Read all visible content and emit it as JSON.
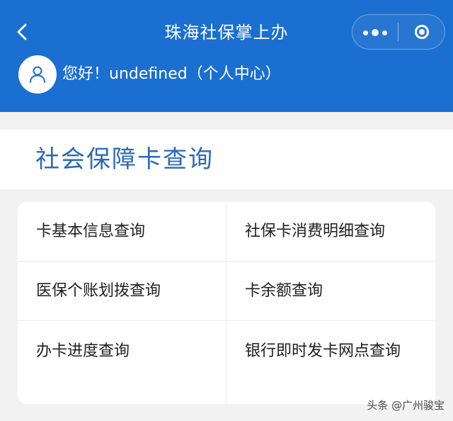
{
  "header": {
    "title": "珠海社保掌上办",
    "back_icon": "chevron-left-icon",
    "capsule": {
      "more_icon": "more-dots-icon",
      "close_icon": "target-close-icon"
    },
    "background_color": "#1a6fd0"
  },
  "user": {
    "avatar_icon": "person-icon",
    "greeting": "您好！undefined（个人中心）"
  },
  "section": {
    "title": "社会保障卡查询",
    "title_color": "#2a6ab5"
  },
  "menu": {
    "items": [
      {
        "label": "卡基本信息查询"
      },
      {
        "label": "社保卡消费明细查询"
      },
      {
        "label": "医保个账划拨查询"
      },
      {
        "label": "卡余额查询"
      },
      {
        "label": "办卡进度查询"
      },
      {
        "label": "银行即时发卡网点查询"
      }
    ]
  },
  "watermark": {
    "text": "头条 @广州骏宝"
  }
}
